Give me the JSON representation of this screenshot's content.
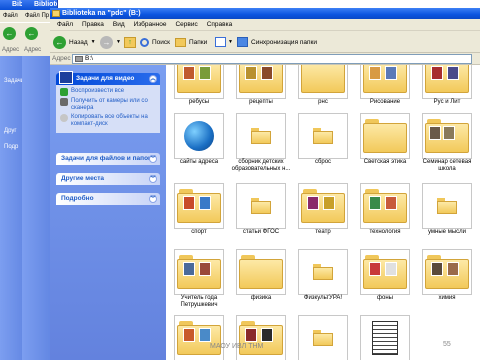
{
  "windows": [
    {
      "title": "Biblioteka na \"pdc\" (B:)"
    },
    {
      "title": "Biblioteka na \"pdc\" (B:)"
    }
  ],
  "main": {
    "title": "Biblioteka na \"pdc\" (B:)",
    "menu": [
      "Файл",
      "Правка",
      "Вид",
      "Избранное",
      "Сервис",
      "Справка"
    ],
    "back_menu": [
      "Файл",
      "Пр"
    ],
    "toolbar": {
      "back": "Назад",
      "search": "Поиск",
      "folders": "Папки",
      "sync": "Синхронизация папки"
    },
    "address": {
      "label": "Адрес",
      "value": "B:\\"
    }
  },
  "taskpane": {
    "video": {
      "title": "Задачи для видео",
      "tasks": [
        "Воспроизвести все",
        "Получить от камеры или со сканера",
        "Копировать все объекты на компакт-диск"
      ]
    },
    "files_title": "Задачи для файлов и папок",
    "other_title": "Другие места",
    "details_title": "Подробно",
    "back_labels": [
      "Задачи",
      "Друг",
      "Подр"
    ]
  },
  "files": [
    {
      "label": "ребусы"
    },
    {
      "label": "рецепты"
    },
    {
      "label": "рнс"
    },
    {
      "label": "Рисование"
    },
    {
      "label": "Рус и Лит"
    },
    {
      "label": "сайты адреса"
    },
    {
      "label": "сборник детских образовательных н..."
    },
    {
      "label": "сброс"
    },
    {
      "label": "Светская этика"
    },
    {
      "label": "Семинар сетевая школа"
    },
    {
      "label": "спорт"
    },
    {
      "label": "статьи ФГОС"
    },
    {
      "label": "театр"
    },
    {
      "label": "технология"
    },
    {
      "label": "умные мысли"
    },
    {
      "label": "Учитель года Петрушкевич"
    },
    {
      "label": "физика"
    },
    {
      "label": "ФизкультУРА!"
    },
    {
      "label": "фоны"
    },
    {
      "label": "химия"
    },
    {
      "label": ""
    },
    {
      "label": ""
    },
    {
      "label": ""
    },
    {
      "label": ""
    },
    {
      "label": ""
    }
  ],
  "footer": {
    "left": "МАОУ ИВЛ ТНМ",
    "right": "55"
  },
  "colors": {
    "xp_blue": "#0b55e0",
    "pane_blue": "#6382de",
    "folder": "#f2c95a"
  }
}
